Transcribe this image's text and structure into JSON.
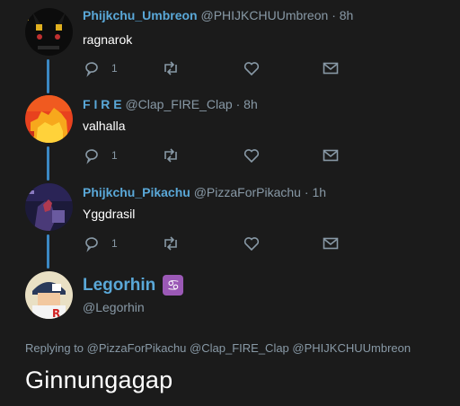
{
  "thread": [
    {
      "name": "Phijkchu_Umbreon",
      "handle": "@PHIJKCHUUmbreon",
      "dot": "·",
      "time": "8h",
      "text": "ragnarok",
      "reply_count": "1",
      "avatar_icon": "umbreon-avatar"
    },
    {
      "name": "F I R E",
      "handle": "@Clap_FIRE_Clap",
      "dot": "·",
      "time": "8h",
      "text": "valhalla",
      "reply_count": "1",
      "avatar_icon": "fire-avatar"
    },
    {
      "name": "Phijkchu_Pikachu",
      "handle": "@PizzaForPikachu",
      "dot": "·",
      "time": "1h",
      "text": "Yggdrasil",
      "reply_count": "1",
      "avatar_icon": "pikachu-avatar"
    }
  ],
  "main_tweet": {
    "name": "Legorhin",
    "zodiac_glyph": "♋",
    "handle": "@Legorhin",
    "replying_prefix": "Replying to",
    "mentions": [
      "@PizzaForPikachu",
      "@Clap_FIRE_Clap",
      "@PHIJKCHUUmbreon"
    ],
    "text": "Ginnungagap"
  },
  "colors": {
    "background": "#1b1b1b",
    "name": "#5aa8d8",
    "muted": "#8899a6",
    "thread_line": "#3b88c3",
    "zodiac_badge": "#9b59b6"
  }
}
